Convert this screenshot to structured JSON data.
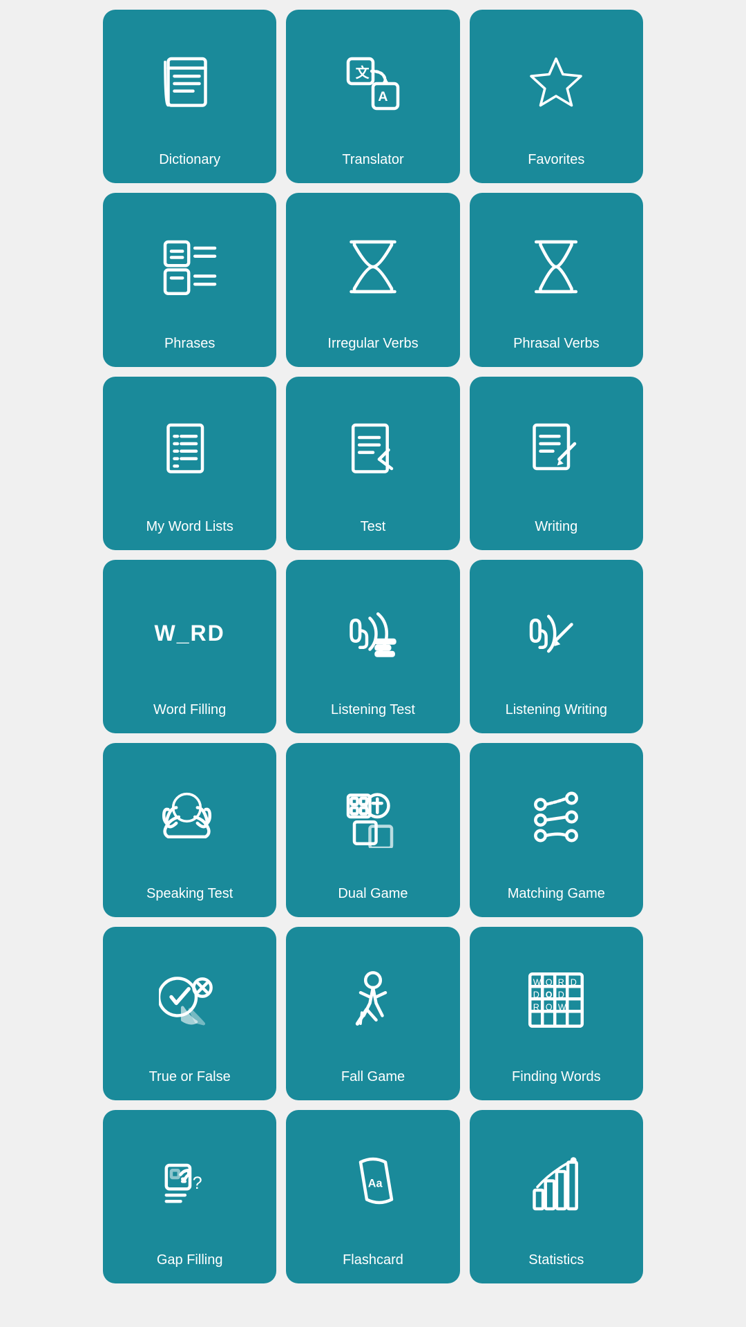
{
  "cards": [
    {
      "id": "dictionary",
      "label": "Dictionary",
      "icon": "dictionary"
    },
    {
      "id": "translator",
      "label": "Translator",
      "icon": "translator"
    },
    {
      "id": "favorites",
      "label": "Favorites",
      "icon": "favorites"
    },
    {
      "id": "phrases",
      "label": "Phrases",
      "icon": "phrases"
    },
    {
      "id": "irregular-verbs",
      "label": "Irregular Verbs",
      "icon": "hourglass"
    },
    {
      "id": "phrasal-verbs",
      "label": "Phrasal Verbs",
      "icon": "hourglass2"
    },
    {
      "id": "my-word-lists",
      "label": "My Word Lists",
      "icon": "wordlists"
    },
    {
      "id": "test",
      "label": "Test",
      "icon": "test"
    },
    {
      "id": "writing",
      "label": "Writing",
      "icon": "writing"
    },
    {
      "id": "word-filling",
      "label": "Word Filling",
      "icon": "wordfilling"
    },
    {
      "id": "listening-test",
      "label": "Listening Test",
      "icon": "listeningtest"
    },
    {
      "id": "listening-writing",
      "label": "Listening Writing",
      "icon": "listeningwriting"
    },
    {
      "id": "speaking-test",
      "label": "Speaking Test",
      "icon": "speakingtest"
    },
    {
      "id": "dual-game",
      "label": "Dual Game",
      "icon": "dualgame"
    },
    {
      "id": "matching-game",
      "label": "Matching Game",
      "icon": "matchinggame"
    },
    {
      "id": "true-or-false",
      "label": "True or False",
      "icon": "trueorfalse"
    },
    {
      "id": "fall-game",
      "label": "Fall Game",
      "icon": "fallgame"
    },
    {
      "id": "finding-words",
      "label": "Finding Words",
      "icon": "findingwords"
    },
    {
      "id": "gap-filling",
      "label": "Gap Filling",
      "icon": "gapfilling"
    },
    {
      "id": "flashcard",
      "label": "Flashcard",
      "icon": "flashcard"
    },
    {
      "id": "statistics",
      "label": "Statistics",
      "icon": "statistics"
    }
  ]
}
